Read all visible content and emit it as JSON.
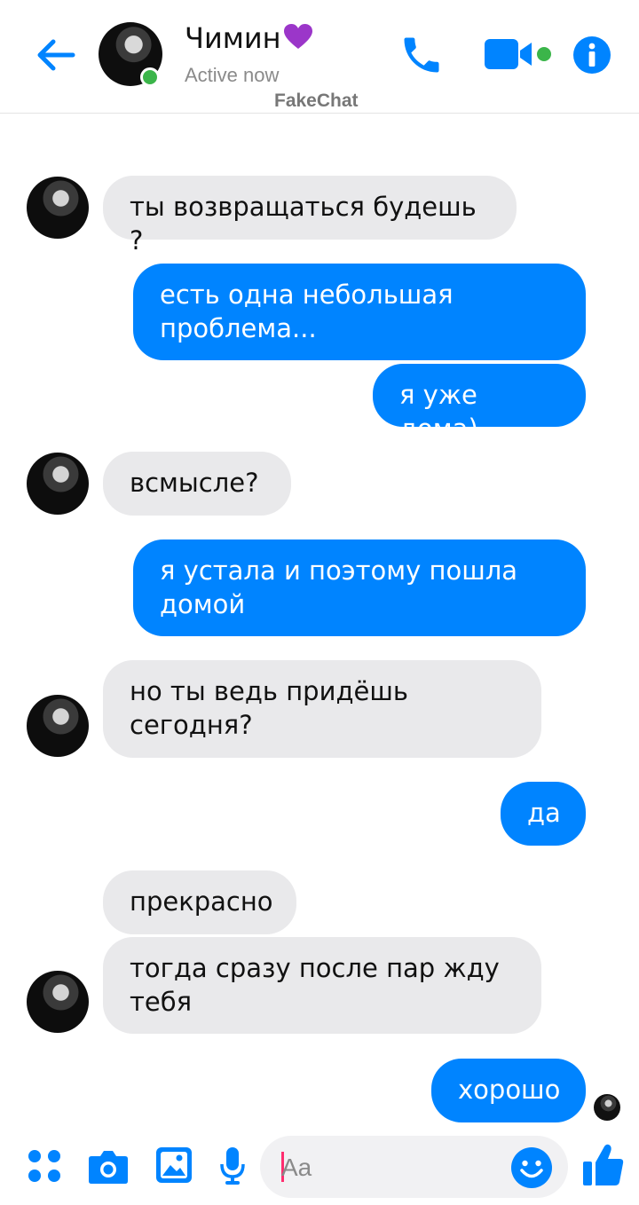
{
  "header": {
    "contact_name": "Чимин",
    "status": "Active now",
    "watermark": "FakeChat"
  },
  "colors": {
    "accent": "#0084ff",
    "incoming_bubble": "#e9e9eb",
    "online": "#3bb54a",
    "heart": "#9b36c9"
  },
  "icons": {
    "back": "arrow-left-icon",
    "call": "phone-icon",
    "video": "video-camera-icon",
    "info": "info-icon",
    "apps": "apps-grid-icon",
    "camera": "camera-icon",
    "gallery": "image-icon",
    "mic": "microphone-icon",
    "emoji": "smiley-icon",
    "like": "thumbs-up-icon"
  },
  "messages": [
    {
      "from": "contact",
      "text": "ты возвращаться будешь ?"
    },
    {
      "from": "me",
      "text": "есть одна небольшая проблема..."
    },
    {
      "from": "me",
      "text": "я уже дома)"
    },
    {
      "from": "contact",
      "text": "всмысле?"
    },
    {
      "from": "me",
      "text": "я устала и поэтому пошла домой"
    },
    {
      "from": "contact",
      "text": "но ты ведь придёшь сегодня?"
    },
    {
      "from": "me",
      "text": "да"
    },
    {
      "from": "contact",
      "text": "прекрасно"
    },
    {
      "from": "contact",
      "text": "тогда сразу после пар жду тебя"
    },
    {
      "from": "me",
      "text": "хорошо"
    }
  ],
  "composer": {
    "placeholder": "Aa"
  }
}
